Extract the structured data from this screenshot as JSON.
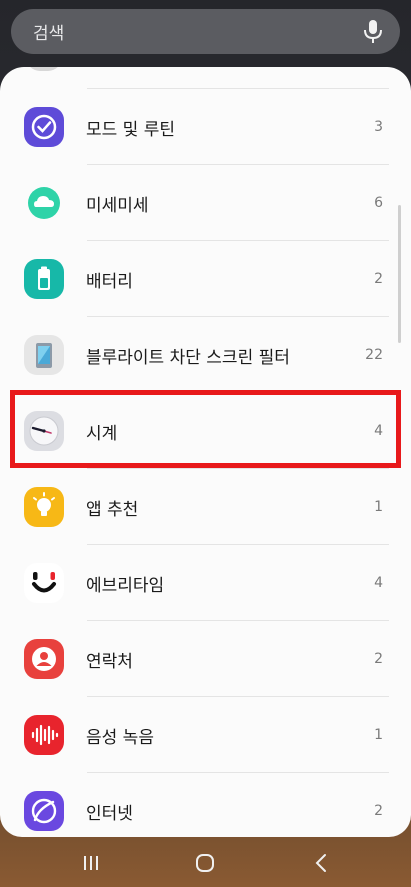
{
  "search": {
    "label": "검색",
    "icon": "microphone-icon"
  },
  "items": [
    {
      "label": "모드 및 루틴",
      "count": "3",
      "icon": "modes-routines-icon",
      "color": "#5e4bd8"
    },
    {
      "label": "미세미세",
      "count": "6",
      "icon": "cloud-icon",
      "color": "#2ed3a8"
    },
    {
      "label": "배터리",
      "count": "2",
      "icon": "battery-icon",
      "color": "#17b8a8"
    },
    {
      "label": "블루라이트 차단 스크린 필터",
      "count": "22",
      "icon": "bluelight-filter-icon",
      "color": "#e6e6e6"
    },
    {
      "label": "시계",
      "count": "4",
      "icon": "clock-icon",
      "color": "#e9eaee"
    },
    {
      "label": "앱 추천",
      "count": "1",
      "icon": "lightbulb-icon",
      "color": "#f7b816"
    },
    {
      "label": "에브리타임",
      "count": "4",
      "icon": "everytime-icon",
      "color": "#ffffff"
    },
    {
      "label": "연락처",
      "count": "2",
      "icon": "contacts-icon",
      "color": "#e8413d"
    },
    {
      "label": "음성 녹음",
      "count": "1",
      "icon": "voice-recorder-icon",
      "color": "#e8242d"
    },
    {
      "label": "인터넷",
      "count": "2",
      "icon": "internet-icon",
      "color": "#6a48e0"
    }
  ],
  "nav": {
    "recent": "recent-apps-icon",
    "home": "home-icon",
    "back": "back-icon"
  },
  "highlight_color": "#e8191b"
}
